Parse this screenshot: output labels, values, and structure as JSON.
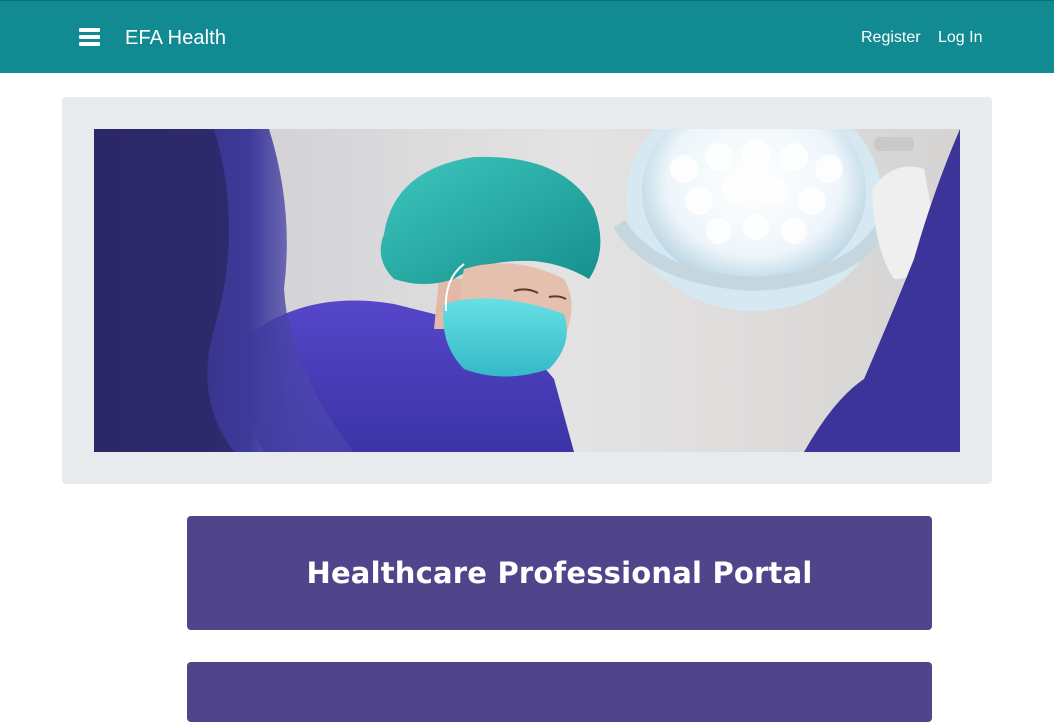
{
  "navbar": {
    "menu_icon": "hamburger-menu-icon",
    "brand": "EFA Health",
    "links": [
      {
        "label": "Register"
      },
      {
        "label": "Log In"
      }
    ],
    "color": "#118a92"
  },
  "hero": {
    "image_alt": "Surgeon in teal cap and mask under operating lights",
    "background": "#e8ebee"
  },
  "portal": {
    "title": "Healthcare Professional Portal",
    "color": "#50458a"
  }
}
